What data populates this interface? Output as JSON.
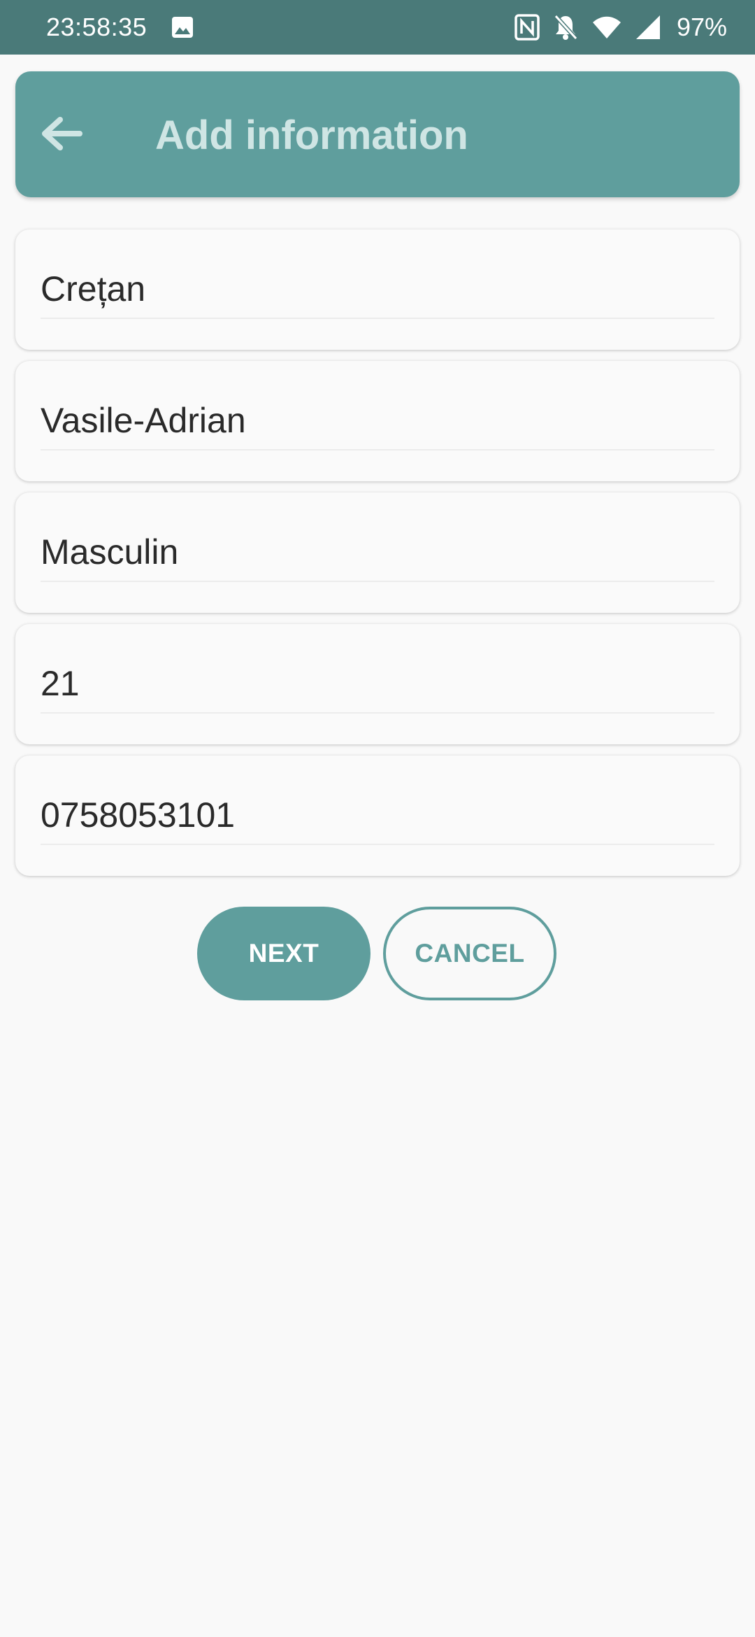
{
  "status_bar": {
    "time": "23:58:35",
    "battery": "97%",
    "icons": [
      "gallery-icon",
      "nfc-icon",
      "notifications-off-icon",
      "wifi-icon",
      "signal-icon"
    ]
  },
  "app_bar": {
    "title": "Add information",
    "back_icon": "arrow-left-icon",
    "background_color": "#5f9e9d",
    "title_color": "#cfe5e4"
  },
  "form": {
    "fields": [
      {
        "value": "Crețan"
      },
      {
        "value": "Vasile-Adrian"
      },
      {
        "value": "Masculin"
      },
      {
        "value": "21"
      },
      {
        "value": "0758053101"
      }
    ]
  },
  "buttons": {
    "next_label": "NEXT",
    "cancel_label": "CANCEL",
    "accent_color": "#5f9e9d"
  }
}
